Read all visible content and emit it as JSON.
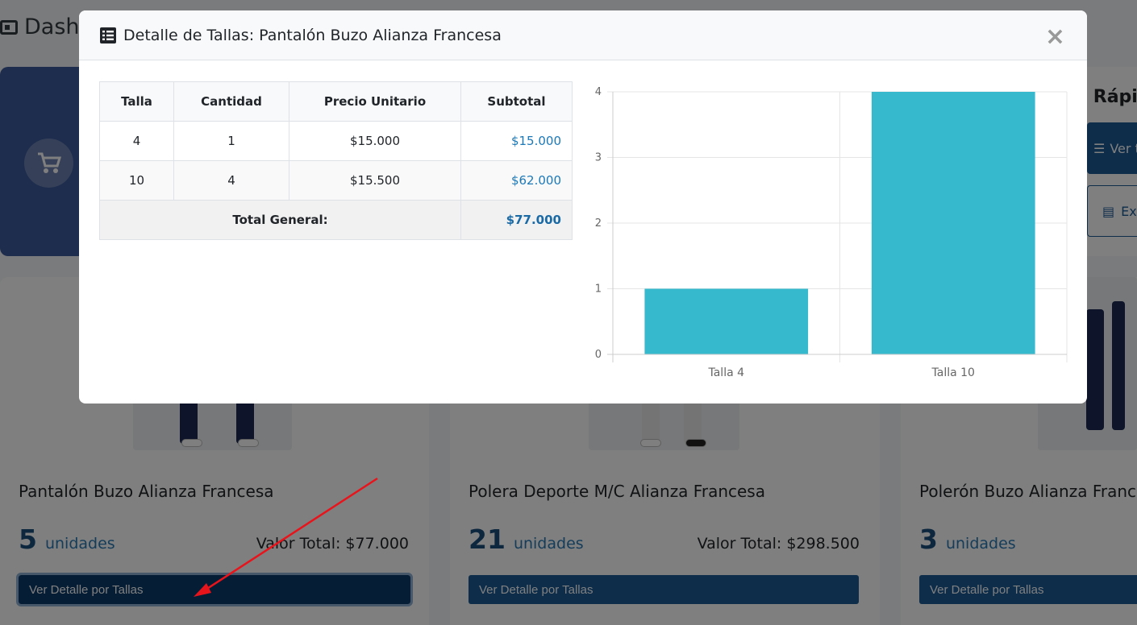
{
  "background": {
    "page_title": "Dash",
    "quick_actions": {
      "title": "s Rápid",
      "button_view": "Ver to",
      "button_export": "Ex"
    },
    "products": [
      {
        "name": "Pantalón Buzo Alianza Francesa",
        "units": "5",
        "units_label": "unidades",
        "total": "Valor Total: $77.000",
        "button": "Ver Detalle por Tallas"
      },
      {
        "name": "Polera Deporte M/C Alianza Francesa",
        "units": "21",
        "units_label": "unidades",
        "total": "Valor Total: $298.500",
        "button": "Ver Detalle por Tallas"
      },
      {
        "name": "Polerón Buzo Alianza France",
        "units": "3",
        "units_label": "unidades",
        "total": "",
        "button": "Ver Detalle por Tallas"
      }
    ]
  },
  "modal": {
    "title": "Detalle de Tallas: Pantalón Buzo Alianza Francesa",
    "close": "×",
    "table": {
      "headers": [
        "Talla",
        "Cantidad",
        "Precio Unitario",
        "Subtotal"
      ],
      "rows": [
        {
          "talla": "4",
          "cantidad": "1",
          "precio": "$15.000",
          "subtotal": "$15.000"
        },
        {
          "talla": "10",
          "cantidad": "4",
          "precio": "$15.500",
          "subtotal": "$62.000"
        }
      ],
      "total_label": "Total General:",
      "total_value": "$77.000"
    }
  },
  "colors": {
    "bar": "#36b9cc",
    "primary": "#1a5a96",
    "link": "#1c79b8"
  },
  "chart_data": {
    "type": "bar",
    "categories": [
      "Talla 4",
      "Talla 10"
    ],
    "values": [
      1,
      4
    ],
    "ylim": [
      0,
      4
    ],
    "yticks": [
      0,
      1,
      2,
      3,
      4
    ],
    "grid": true,
    "legend": "none"
  }
}
